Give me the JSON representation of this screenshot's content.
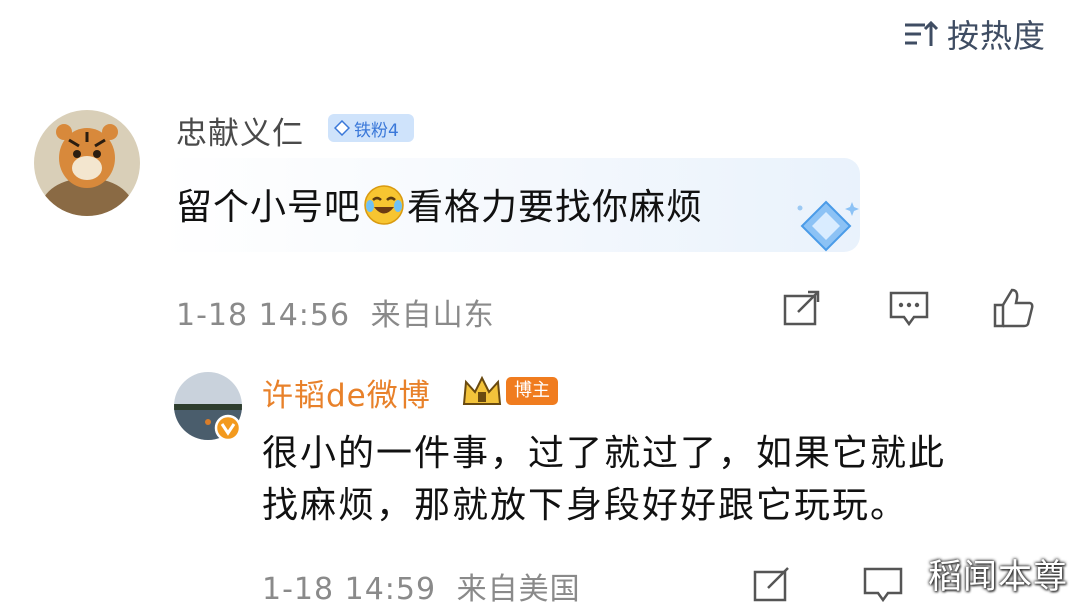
{
  "sort": {
    "label": "按热度",
    "icon": "sort-icon"
  },
  "comment": {
    "author": "忠献义仁",
    "fan_badge": "铁粉4",
    "text_before": "留个小号吧",
    "emoji": "laugh-cry-emoji",
    "text_after": "看格力要找你麻烦",
    "time": "1-18 14:56",
    "location": "来自山东",
    "actions": [
      "share-icon",
      "comment-icon",
      "like-icon"
    ]
  },
  "reply": {
    "author": "许韬de微博",
    "role_badge": "博主",
    "lines": [
      "很小的一件事，过了就过了，如果它就此",
      "找麻烦，那就放下身段好好跟它玩玩。"
    ],
    "time": "1-18 14:59",
    "location": "来自美国"
  },
  "watermark": "稻闻本尊",
  "colors": {
    "accent_orange": "#e8812a",
    "badge_blue": "#3a78d9",
    "meta_gray": "#8a8a8a"
  }
}
